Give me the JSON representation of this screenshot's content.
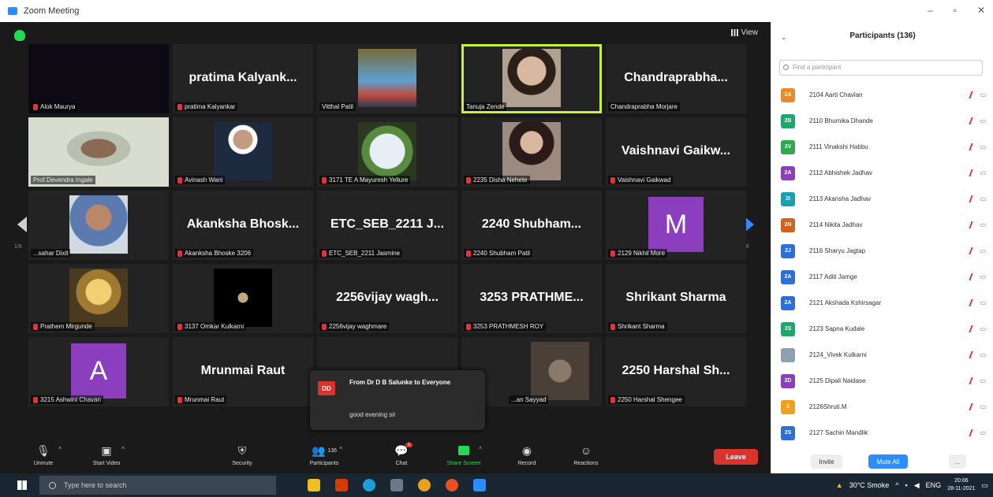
{
  "window": {
    "title": "Zoom Meeting"
  },
  "view_button": "View",
  "pages": {
    "left": "1/6",
    "right": "1/6"
  },
  "tiles": [
    {
      "label": "Alok Maurya",
      "big": ""
    },
    {
      "label": "pratima Kalyankar",
      "big": "pratima  Kalyank..."
    },
    {
      "label": "Vitthal Patil",
      "big": ""
    },
    {
      "label": "Tanuja Zende",
      "big": ""
    },
    {
      "label": "Chandraprabha Morjare",
      "big": "Chandraprabha..."
    },
    {
      "label": "Prof.Devendra Ingale",
      "big": ""
    },
    {
      "label": "Avinash Wani",
      "big": ""
    },
    {
      "label": "3171 TE A Mayuresh Yellure",
      "big": ""
    },
    {
      "label": "2235 Disha Nehete",
      "big": ""
    },
    {
      "label": "Vaishnavi Gaikwad",
      "big": "Vaishnavi  Gaikw..."
    },
    {
      "label": "...sahar Dixit",
      "big": ""
    },
    {
      "label": "Akanksha Bhoske 3206",
      "big": "Akanksha  Bhosk..."
    },
    {
      "label": "ETC_SEB_2211 Jasmine",
      "big": "ETC_SEB_2211  J..."
    },
    {
      "label": "2240 Shubham Patil",
      "big": "2240  Shubham..."
    },
    {
      "label": "2129 Nikhil More",
      "big": "",
      "avatar": "M"
    },
    {
      "label": "Prathem Mirgunde",
      "big": ""
    },
    {
      "label": "3137 Omkar Kulkarni",
      "big": ""
    },
    {
      "label": "2256vijay waghmare",
      "big": "2256vijay  wagh..."
    },
    {
      "label": "3253 PRATHMESH ROY",
      "big": "3253  PRATHME..."
    },
    {
      "label": "Shrikant Sharma",
      "big": "Shrikant Sharma"
    },
    {
      "label": "3215 Ashwini Chavan",
      "big": "",
      "avatar": "A"
    },
    {
      "label": "Mrunmai Raut",
      "big": "Mrunmai Raut"
    },
    {
      "label": "",
      "big": ""
    },
    {
      "label": "...an Sayyad",
      "big": ""
    },
    {
      "label": "2250 Harshal Shengee",
      "big": "2250  Harshal  Sh..."
    }
  ],
  "chat_popup": {
    "initials": "DD",
    "from": "From Dr D B Salunke to Everyone",
    "message": "good evening sir"
  },
  "toolbar": {
    "unmute": "Unmute",
    "start_video": "Start Video",
    "security": "Security",
    "participants": "Participants",
    "participants_count": "136",
    "chat": "Chat",
    "chat_badge": "1",
    "share_screen": "Share Screen",
    "record": "Record",
    "reactions": "Reactions",
    "leave": "Leave"
  },
  "panel": {
    "title": "Participants (136)",
    "search_placeholder": "Find a participant",
    "participants": [
      {
        "initials": "2A",
        "name": "2104 Aarti Chavlan",
        "color": "#e88a2e"
      },
      {
        "initials": "2B",
        "name": "2110 Bhumika Dhande",
        "color": "#1aa86b"
      },
      {
        "initials": "2V",
        "name": "2111 Vinakshi Habbu",
        "color": "#2fa84f"
      },
      {
        "initials": "2A",
        "name": "2112 Abhishek Jadhav",
        "color": "#8b3fbf"
      },
      {
        "initials": "2I",
        "name": "2113 Akansha Jadhav",
        "color": "#1a9fb0"
      },
      {
        "initials": "2N",
        "name": "2114 Nikita Jadhav",
        "color": "#d9601a"
      },
      {
        "initials": "2J",
        "name": "2116 Sharyu Jagtap",
        "color": "#2d6fd8"
      },
      {
        "initials": "2A",
        "name": "2117 Aditi Jamge",
        "color": "#2d6fd8"
      },
      {
        "initials": "2A",
        "name": "2121 Akshada Kshirsagar",
        "color": "#2d6fd8"
      },
      {
        "initials": "2S",
        "name": "2123 Sapna Kudale",
        "color": "#1aa86b"
      },
      {
        "initials": "",
        "name": "2124_Vivek Kulkarni",
        "color": "#8fa0b0"
      },
      {
        "initials": "2D",
        "name": "2125 Dipali Naidase",
        "color": "#8b3fbf"
      },
      {
        "initials": "2",
        "name": "2126Shruti.M",
        "color": "#f0a020"
      },
      {
        "initials": "2S",
        "name": "2127 Sachin Mandlik",
        "color": "#2d6fd8"
      }
    ],
    "invite": "Invite",
    "mute_all": "Mute All",
    "more": "..."
  },
  "taskbar": {
    "search_placeholder": "Type here to search",
    "weather": "30°C  Smoke",
    "language": "ENG",
    "time": "20:06",
    "date": "28-11-2021"
  }
}
